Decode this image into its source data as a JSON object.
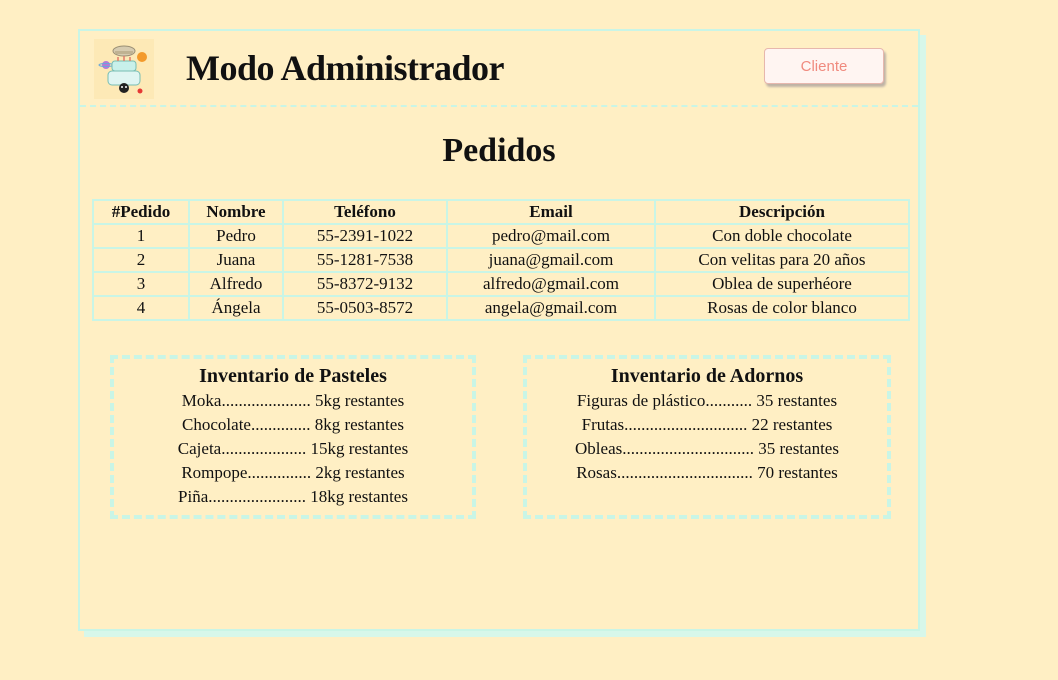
{
  "header": {
    "title": "Modo Administrador",
    "client_button": "Cliente"
  },
  "orders": {
    "title": "Pedidos",
    "columns": [
      "#Pedido",
      "Nombre",
      "Teléfono",
      "Email",
      "Descripción"
    ],
    "rows": [
      [
        "1",
        "Pedro",
        "55-2391-1022",
        "pedro@mail.com",
        "Con doble chocolate"
      ],
      [
        "2",
        "Juana",
        "55-1281-7538",
        "juana@gmail.com",
        "Con velitas para 20 años"
      ],
      [
        "3",
        "Alfredo",
        "55-8372-9132",
        "alfredo@gmail.com",
        "Oblea de superhéore"
      ],
      [
        "4",
        "Ángela",
        "55-0503-8572",
        "angela@gmail.com",
        "Rosas de color blanco"
      ]
    ]
  },
  "cakes": {
    "title": "Inventario de Pasteles",
    "items": [
      "Moka..................... 5kg restantes",
      "Chocolate.............. 8kg restantes",
      "Cajeta.................... 15kg restantes",
      "Rompope............... 2kg restantes",
      "Piña....................... 18kg restantes"
    ]
  },
  "decorations": {
    "title": "Inventario de Adornos",
    "items": [
      "Figuras de plástico........... 35 restantes",
      "Frutas............................. 22 restantes",
      "Obleas............................... 35 restantes",
      "Rosas................................ 70 restantes"
    ]
  },
  "colors": {
    "background": "#ffefc4",
    "border": "#c9f5e6",
    "button_text": "#f08a7e"
  }
}
